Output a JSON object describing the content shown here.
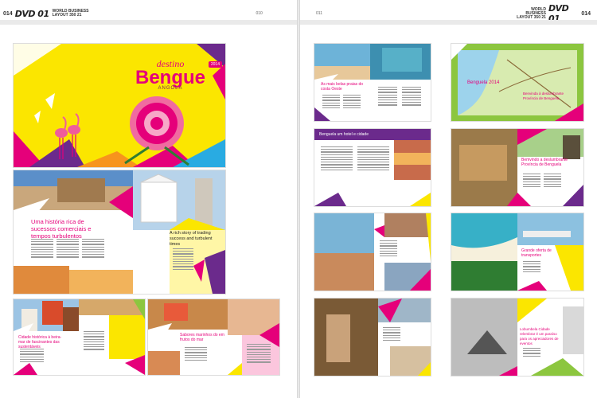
{
  "header_left": {
    "page_number": "014",
    "logo": "DVD 01",
    "section": "WORLD BUSINESS",
    "subsection": "LAYOUT 350 21",
    "folio": "010"
  },
  "header_right": {
    "page_number": "014",
    "logo": "DVD 01",
    "section": "WORLD BUSINESS",
    "subsection": "LAYOUT 350 21",
    "folio": "011"
  },
  "cover": {
    "destino": "destino",
    "title": "Bengue",
    "subtitle": "ANGOLA",
    "badge": "2014"
  },
  "history": {
    "title": "Uma história rica de sucessos comerciais e tempos turbulentos",
    "title_en": "A rich story of trading success and turbulent times"
  },
  "small_spreads": {
    "s1_title": "Cidade histórica à beira-mar de fascinantes das sustentáveis",
    "s2_title": "Sabores marinhos do em frutos do mar",
    "r1_title": "As mais belas praias do costa Oeste",
    "r2_title": "Benguela 2014",
    "r2b_title": "Benvinda à deslumbrante Província de Benguela",
    "r3_title": "Benguela um hotel e cidade",
    "r4_title": "Bemvindo a deslumbrante Província de Benguela",
    "r6_title": "Grande oferta de transportes",
    "r8_title": "Lobumbela Cidade relembrar é um paraíso para os apreciadores de eventos"
  },
  "colors": {
    "magenta": "#e5007a",
    "yellow": "#fbe600",
    "purple": "#6b2a8c",
    "green": "#8cc63f",
    "blue": "#29abe2",
    "orange": "#f7941d"
  }
}
